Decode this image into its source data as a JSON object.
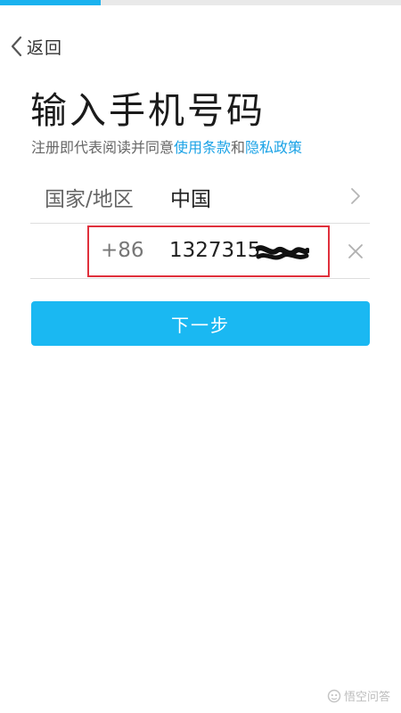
{
  "progress": {
    "fraction": 0.25,
    "fill_color": "#1ab2ef"
  },
  "nav": {
    "back_label": "返回",
    "back_icon": "chevron-left-icon"
  },
  "header": {
    "title": "输入手机号码"
  },
  "agreement": {
    "prefix": "注册即代表阅读并同意",
    "terms_link": "使用条款",
    "and": "和",
    "privacy_link": "隐私政策",
    "link_color": "#1aa2e6"
  },
  "region_row": {
    "label": "国家/地区",
    "value": "中国",
    "chevron_icon": "chevron-right-icon"
  },
  "phone_row": {
    "country_code": "+86",
    "number_visible": "1327315",
    "clear_icon": "close-icon",
    "highlight_color": "#e0303c"
  },
  "actions": {
    "next_label": "下一步",
    "button_color": "#1ab8f2"
  },
  "watermark": {
    "text": "悟空问答",
    "icon": "wukong-logo-icon"
  }
}
